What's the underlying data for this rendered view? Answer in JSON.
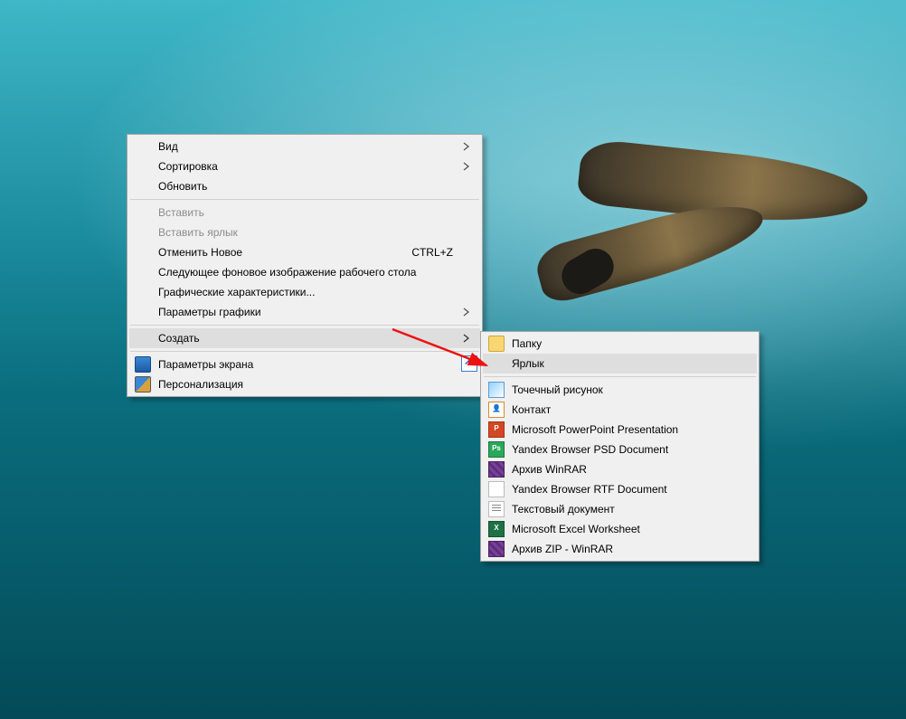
{
  "main_menu": {
    "items": [
      {
        "label": "Вид",
        "submenu": true
      },
      {
        "label": "Сортировка",
        "submenu": true
      },
      {
        "label": "Обновить"
      },
      {
        "sep": true
      },
      {
        "label": "Вставить",
        "disabled": true
      },
      {
        "label": "Вставить ярлык",
        "disabled": true
      },
      {
        "label": "Отменить Новое",
        "shortcut": "CTRL+Z"
      },
      {
        "label": "Следующее фоновое изображение рабочего стола"
      },
      {
        "label": "Графические характеристики..."
      },
      {
        "label": "Параметры графики",
        "submenu": true
      },
      {
        "sep": true
      },
      {
        "label": "Создать",
        "submenu": true,
        "highlight": true
      },
      {
        "sep": true
      },
      {
        "label": "Параметры экрана",
        "icon": "display"
      },
      {
        "label": "Персонализация",
        "icon": "personalize"
      }
    ]
  },
  "sub_menu": {
    "items": [
      {
        "label": "Папку",
        "icon": "folder"
      },
      {
        "label": "Ярлык",
        "icon": "shortcut",
        "highlight": true
      },
      {
        "sep": true
      },
      {
        "label": "Точечный рисунок",
        "icon": "bmp"
      },
      {
        "label": "Контакт",
        "icon": "contact"
      },
      {
        "label": "Microsoft PowerPoint Presentation",
        "icon": "ppt"
      },
      {
        "label": "Yandex Browser PSD Document",
        "icon": "psd"
      },
      {
        "label": "Архив WinRAR",
        "icon": "rar"
      },
      {
        "label": "Yandex Browser RTF Document",
        "icon": "rtf"
      },
      {
        "label": "Текстовый документ",
        "icon": "txt"
      },
      {
        "label": "Microsoft Excel Worksheet",
        "icon": "xls"
      },
      {
        "label": "Архив ZIP - WinRAR",
        "icon": "zip"
      }
    ]
  }
}
